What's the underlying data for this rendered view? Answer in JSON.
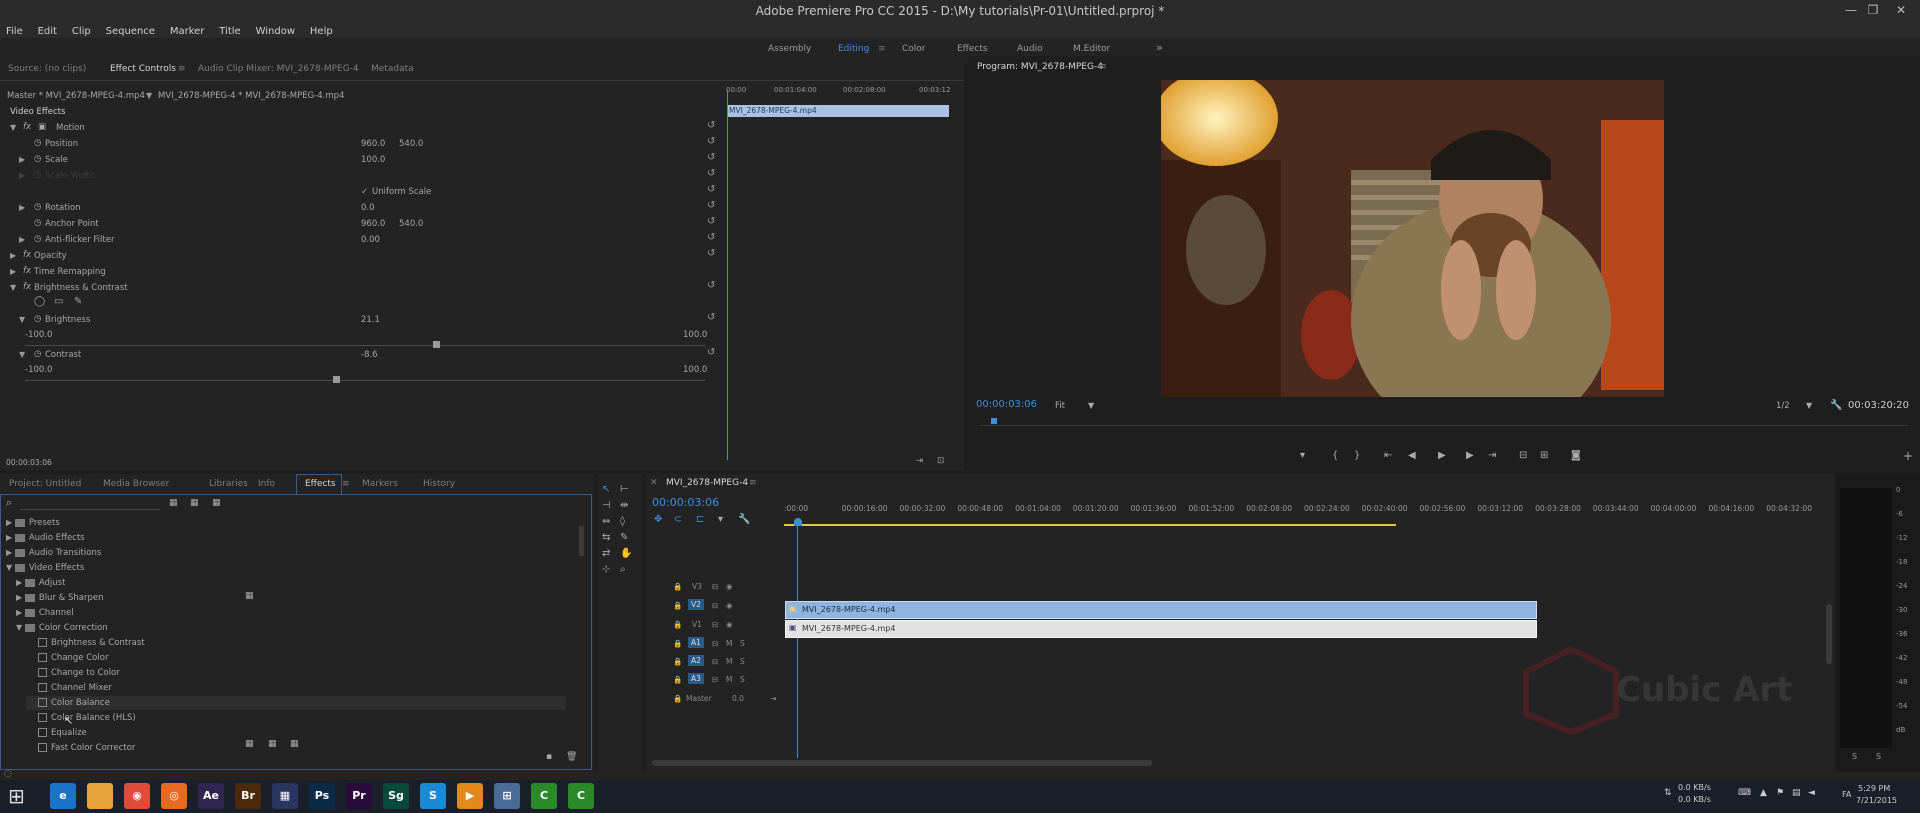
{
  "window": {
    "title": "Adobe Premiere Pro CC 2015 - D:\\My tutorials\\Pr-01\\Untitled.prproj *",
    "controls": [
      "—",
      "❐",
      "✕"
    ]
  },
  "menu": [
    "File",
    "Edit",
    "Clip",
    "Sequence",
    "Marker",
    "Title",
    "Window",
    "Help"
  ],
  "workspaces": [
    "Assembly",
    "Editing",
    "Color",
    "Effects",
    "Audio",
    "M.Editor",
    "»"
  ],
  "source_tabs": [
    "Source: (no clips)",
    "Effect Controls",
    "Audio Clip Mixer: MVI_2678-MPEG-4",
    "Metadata"
  ],
  "effect_controls": {
    "master": "Master * MVI_2678-MPEG-4.mp4",
    "clip": "MVI_2678-MPEG-4 * MVI_2678-MPEG-4.mp4",
    "section": "Video Effects",
    "mini_times": [
      "00:00",
      "00:01:04:00",
      "00:02:08:00",
      "00:03:12"
    ],
    "mini_clip": "MVI_2678-MPEG-4.mp4",
    "motion": "Motion",
    "position_label": "Position",
    "position_x": "960.0",
    "position_y": "540.0",
    "scale_label": "Scale",
    "scale_val": "100.0",
    "scale_width_label": "Scale Width",
    "uniform_scale": "Uniform Scale",
    "rotation_label": "Rotation",
    "rotation_val": "0.0",
    "anchor_label": "Anchor Point",
    "anchor_x": "960.0",
    "anchor_y": "540.0",
    "antiflicker_label": "Anti-flicker Filter",
    "antiflicker_val": "0.00",
    "opacity_label": "Opacity",
    "timeremap_label": "Time Remapping",
    "bc_label": "Brightness & Contrast",
    "brightness_label": "Brightness",
    "brightness_val": "21.1",
    "brightness_min": "-100.0",
    "brightness_max": "100.0",
    "brightness_level": 0.605,
    "contrast_label": "Contrast",
    "contrast_val": "-8.6",
    "contrast_min": "-100.0",
    "contrast_max": "100.0",
    "contrast_level": 0.457,
    "timecode": "00:00:03:06"
  },
  "program": {
    "title": "Program: MVI_2678-MPEG-4",
    "timecode": "00:00:03:06",
    "fit": "Fit",
    "resolution": "1/2",
    "duration": "00:03:20:20",
    "playhead_fraction": 0.015
  },
  "project_tabs": [
    "Project: Untitled",
    "Media Browser",
    "Libraries",
    "Info",
    "Effects",
    "Markers",
    "History"
  ],
  "effects_tree": [
    {
      "label": "Presets",
      "depth": 0,
      "type": "folder",
      "open": false
    },
    {
      "label": "Audio Effects",
      "depth": 0,
      "type": "folder",
      "open": false
    },
    {
      "label": "Audio Transitions",
      "depth": 0,
      "type": "folder",
      "open": false
    },
    {
      "label": "Video Effects",
      "depth": 0,
      "type": "folder",
      "open": true
    },
    {
      "label": "Adjust",
      "depth": 1,
      "type": "folder",
      "open": false
    },
    {
      "label": "Blur & Sharpen",
      "depth": 1,
      "type": "folder",
      "open": false
    },
    {
      "label": "Channel",
      "depth": 1,
      "type": "folder",
      "open": false
    },
    {
      "label": "Color Correction",
      "depth": 1,
      "type": "folder",
      "open": true
    },
    {
      "label": "Brightness & Contrast",
      "depth": 2,
      "type": "effect"
    },
    {
      "label": "Change Color",
      "depth": 2,
      "type": "effect"
    },
    {
      "label": "Change to Color",
      "depth": 2,
      "type": "effect"
    },
    {
      "label": "Channel Mixer",
      "depth": 2,
      "type": "effect"
    },
    {
      "label": "Color Balance",
      "depth": 2,
      "type": "effect"
    },
    {
      "label": "Color Balance (HLS)",
      "depth": 2,
      "type": "effect"
    },
    {
      "label": "Equalize",
      "depth": 2,
      "type": "effect"
    },
    {
      "label": "Fast Color Corrector",
      "depth": 2,
      "type": "effect"
    }
  ],
  "timeline": {
    "title": "MVI_2678-MPEG-4",
    "timecode": "00:00:03:06",
    "ruler": [
      ":00:00",
      "00:00:16:00",
      "00:00:32:00",
      "00:00:48:00",
      "00:01:04:00",
      "00:01:20:00",
      "00:01:36:00",
      "00:01:52:00",
      "00:02:08:00",
      "00:02:24:00",
      "00:02:40:00",
      "00:02:56:00",
      "00:03:12:00",
      "00:03:28:00",
      "00:03:44:00",
      "00:04:00:00",
      "00:04:16:00",
      "00:04:32:00"
    ],
    "tracks": [
      "V3",
      "V2",
      "V1",
      "A1",
      "A2",
      "A3"
    ],
    "master_label": "Master",
    "master_val": "0.0",
    "clip_v2": "MVI_2678-MPEG-4.mp4",
    "clip_v1": "MVI_2678-MPEG-4.mp4",
    "watermark": "Cubic Art"
  },
  "meter_scale": [
    "0",
    "-6",
    "-12",
    "-18",
    "-24",
    "-30",
    "-36",
    "-42",
    "-48",
    "-54",
    "dB"
  ],
  "meter_bottom": [
    "S",
    "S"
  ],
  "taskbar": {
    "net_up": "0.0 KB/s",
    "net_down": "0.0 KB/s",
    "lang": "FA",
    "time": "5:29 PM",
    "date": "7/21/2015",
    "apps": [
      {
        "label": "e",
        "color": "#1a73c9"
      },
      {
        "label": "",
        "color": "#e8a33a"
      },
      {
        "label": "◉",
        "color": "#dd4b39"
      },
      {
        "label": "◎",
        "color": "#e86a1e"
      },
      {
        "label": "Ae",
        "color": "#2f2550"
      },
      {
        "label": "Br",
        "color": "#4a2a0a"
      },
      {
        "label": "▦",
        "color": "#2a3560"
      },
      {
        "label": "Ps",
        "color": "#0a2a46"
      },
      {
        "label": "Pr",
        "color": "#2a0a3a"
      },
      {
        "label": "Sg",
        "color": "#0a4a3a"
      },
      {
        "label": "S",
        "color": "#1a8ad6"
      },
      {
        "label": "▶",
        "color": "#e08a1e"
      },
      {
        "label": "⊞",
        "color": "#4a6a9a"
      },
      {
        "label": "C",
        "color": "#2a8a2a"
      },
      {
        "label": "C",
        "color": "#2a8a2a"
      }
    ]
  }
}
